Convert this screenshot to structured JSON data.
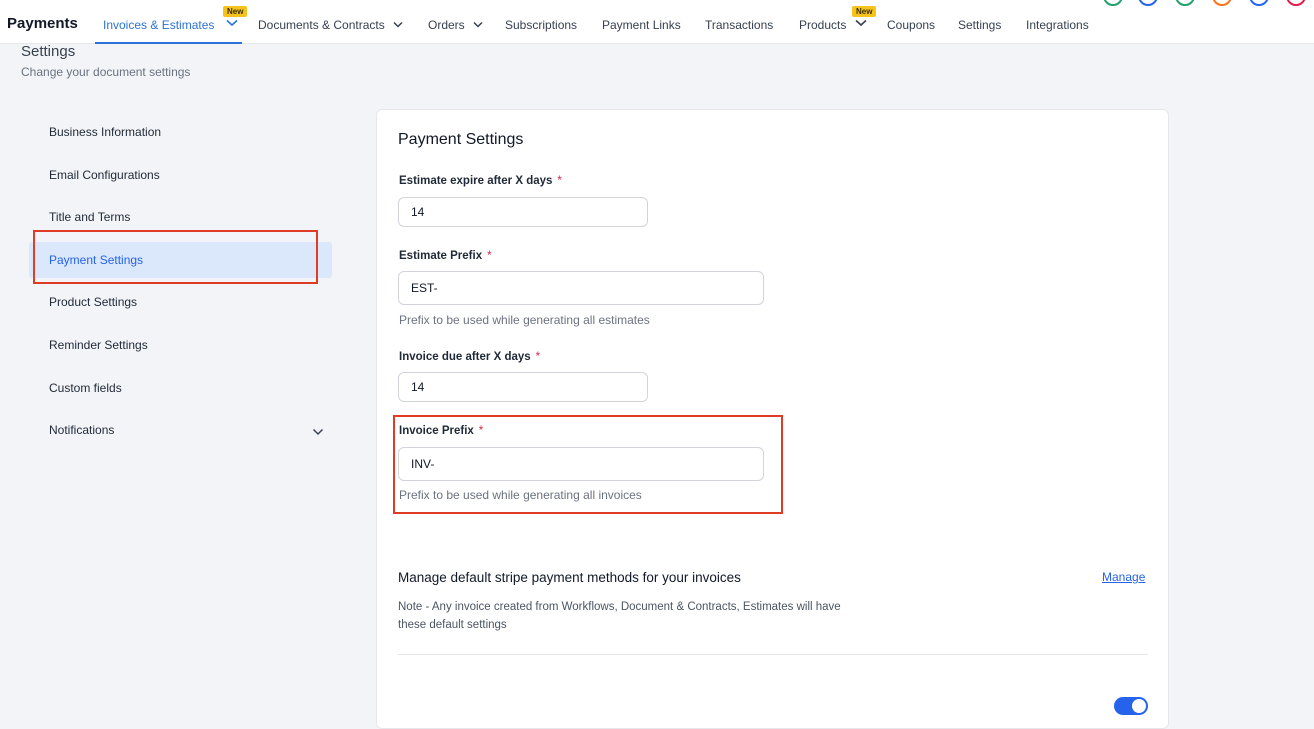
{
  "app": {
    "title": "Payments"
  },
  "nav": {
    "tabs": [
      {
        "label": "Invoices & Estimates",
        "active": true,
        "badge": "New",
        "dropdown": true
      },
      {
        "label": "Documents & Contracts",
        "dropdown": true
      },
      {
        "label": "Orders",
        "dropdown": true
      },
      {
        "label": "Subscriptions"
      },
      {
        "label": "Payment Links"
      },
      {
        "label": "Transactions"
      },
      {
        "label": "Products",
        "badge": "New",
        "dropdown": true
      },
      {
        "label": "Coupons"
      },
      {
        "label": "Settings"
      },
      {
        "label": "Integrations"
      }
    ]
  },
  "page": {
    "title": "Settings",
    "subtitle": "Change your document settings"
  },
  "sidebar": {
    "items": [
      {
        "label": "Business Information"
      },
      {
        "label": "Email Configurations"
      },
      {
        "label": "Title and Terms"
      },
      {
        "label": "Payment Settings",
        "active": true
      },
      {
        "label": "Product Settings"
      },
      {
        "label": "Reminder Settings"
      },
      {
        "label": "Custom fields"
      },
      {
        "label": "Notifications",
        "dropdown": true
      }
    ]
  },
  "form": {
    "title": "Payment Settings",
    "estimate_expire": {
      "label": "Estimate expire after X days",
      "required_mark": "*",
      "value": "14"
    },
    "estimate_prefix": {
      "label": "Estimate Prefix",
      "required_mark": "*",
      "value": "EST-",
      "help": "Prefix to be used while generating all estimates"
    },
    "invoice_due": {
      "label": "Invoice due after X days",
      "required_mark": "*",
      "value": "14"
    },
    "invoice_prefix": {
      "label": "Invoice Prefix",
      "required_mark": "*",
      "value": "INV-",
      "help": "Prefix to be used while generating all invoices"
    },
    "stripe": {
      "title": "Manage default stripe payment methods for your invoices",
      "manage_label": "Manage",
      "note": "Note - Any invoice created from Workflows, Document & Contracts, Estimates will have these default settings"
    }
  },
  "colors": {
    "accent": "#2b73d8",
    "highlight_box": "#e03b24",
    "new_badge": "#f6c21c",
    "active_nav_bg": "#dbe7fb",
    "required_asterisk": "#e11d48"
  },
  "icons": [
    "chevron-down-icon"
  ]
}
